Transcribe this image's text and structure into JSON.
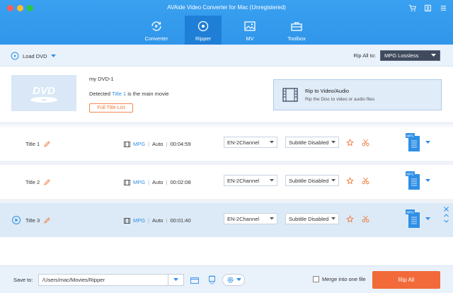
{
  "window": {
    "title": "AVAide Video Converter for Mac (Unregistered)"
  },
  "nav": {
    "tabs": [
      {
        "label": "Converter"
      },
      {
        "label": "Ripper"
      },
      {
        "label": "MV"
      },
      {
        "label": "Toolbox"
      }
    ],
    "active": "Ripper"
  },
  "toolbar": {
    "load_dvd": "Load DVD",
    "rip_all_to_label": "Rip All to:",
    "rip_all_to_value": "MPG Lossless"
  },
  "disc": {
    "thumb_text": "DVD",
    "name": "my DVD-1",
    "detected_prefix": "Detected",
    "detected_title": "Title 1",
    "detected_suffix": "is the main movie",
    "full_title_list": "Full Title List",
    "rip_to_title": "Rip to Video/Audio",
    "rip_to_desc": "Rip the Disc to video or audio files"
  },
  "titles": [
    {
      "name": "Title 1",
      "format": "MPG",
      "quality": "Auto",
      "duration": "00:04:59",
      "audio": "EN-2Channel",
      "subtitle": "Subtitle Disabled",
      "out_badge": "MPG"
    },
    {
      "name": "Title 2",
      "format": "MPG",
      "quality": "Auto",
      "duration": "00:02:08",
      "audio": "EN-2Channel",
      "subtitle": "Subtitle Disabled",
      "out_badge": "MPG"
    },
    {
      "name": "Title 3",
      "format": "MPG",
      "quality": "Auto",
      "duration": "00:01:40",
      "audio": "EN-2Channel",
      "subtitle": "Subtitle Disabled",
      "out_badge": "MPG"
    }
  ],
  "bottom": {
    "save_to_label": "Save to:",
    "save_path": "/Users/mac/Movies/Ripper",
    "merge_label": "Merge into one file",
    "rip_all_button": "Rip All"
  },
  "colors": {
    "accent": "#2f96ea",
    "nav_active": "#1f7fd6",
    "rip_button": "#f26a3a",
    "selected_row": "#dceaf7"
  }
}
